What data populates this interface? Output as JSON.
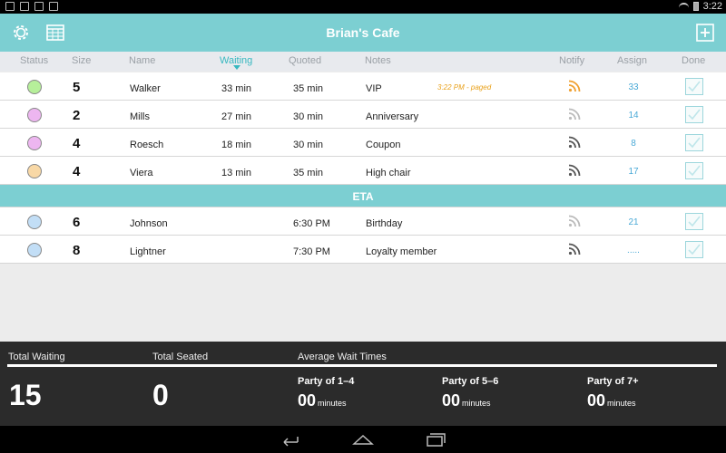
{
  "status_bar": {
    "time": "3:22"
  },
  "app": {
    "title": "Brian's Cafe"
  },
  "icons": {
    "settings": "gear-icon",
    "calendar": "calendar-icon",
    "add": "plus-square-icon"
  },
  "colors": {
    "accent": "#7ccfd2",
    "active_sort": "#38b8c0",
    "paged": "#e9a11a",
    "notify_active": "#f0a030",
    "assign": "#4aa9d6"
  },
  "columns": {
    "status": "Status",
    "size": "Size",
    "name": "Name",
    "waiting": "Waiting",
    "quoted": "Quoted",
    "notes": "Notes",
    "notify": "Notify",
    "assign": "Assign",
    "done": "Done"
  },
  "waiting_rows": [
    {
      "status_color": "#b6ef9a",
      "size": "5",
      "name": "Walker",
      "waiting": "33 min",
      "quoted": "35 min",
      "notes": "VIP",
      "paged": "3:22 PM - paged",
      "notify": "active",
      "assign": "33"
    },
    {
      "status_color": "#edb6f0",
      "size": "2",
      "name": "Mills",
      "waiting": "27 min",
      "quoted": "30 min",
      "notes": "Anniversary",
      "paged": "",
      "notify": "inactive",
      "assign": "14"
    },
    {
      "status_color": "#edb6f0",
      "size": "4",
      "name": "Roesch",
      "waiting": "18 min",
      "quoted": "30 min",
      "notes": "Coupon",
      "paged": "",
      "notify": "dark",
      "assign": "8"
    },
    {
      "status_color": "#f8d8a6",
      "size": "4",
      "name": "Viera",
      "waiting": "13 min",
      "quoted": "35 min",
      "notes": "High chair",
      "paged": "",
      "notify": "dark",
      "assign": "17"
    }
  ],
  "eta_label": "ETA",
  "eta_rows": [
    {
      "status_color": "#c2def6",
      "size": "6",
      "name": "Johnson",
      "waiting": "",
      "quoted": "6:30 PM",
      "notes": "Birthday",
      "paged": "",
      "notify": "inactive",
      "assign": "21"
    },
    {
      "status_color": "#c2def6",
      "size": "8",
      "name": "Lightner",
      "waiting": "",
      "quoted": "7:30 PM",
      "notes": "Loyalty member",
      "paged": "",
      "notify": "dark",
      "assign": "....."
    }
  ],
  "footer": {
    "total_waiting_label": "Total Waiting",
    "total_waiting_value": "15",
    "total_seated_label": "Total Seated",
    "total_seated_value": "0",
    "avg_label": "Average Wait Times",
    "parties": [
      {
        "label": "Party of 1–4",
        "value": "00",
        "unit": "minutes"
      },
      {
        "label": "Party of 5–6",
        "value": "00",
        "unit": "minutes"
      },
      {
        "label": "Party of 7+",
        "value": "00",
        "unit": "minutes"
      }
    ]
  }
}
